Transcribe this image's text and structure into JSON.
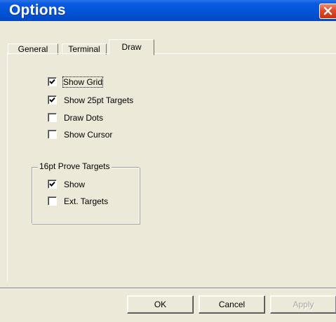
{
  "window": {
    "title": "Options"
  },
  "tabs": [
    {
      "label": "General",
      "active": false
    },
    {
      "label": "Terminal",
      "active": false
    },
    {
      "label": "Draw",
      "active": true
    }
  ],
  "draw": {
    "checkboxes": [
      {
        "label": "Show Grid",
        "checked": true
      },
      {
        "label": "Show 25pt Targets",
        "checked": true
      },
      {
        "label": "Draw Dots",
        "checked": false
      },
      {
        "label": "Show Cursor",
        "checked": false
      }
    ],
    "prove_targets": {
      "title": "16pt Prove Targets",
      "checkboxes": [
        {
          "label": "Show",
          "checked": true
        },
        {
          "label": "Ext. Targets",
          "checked": false
        }
      ]
    }
  },
  "buttons": {
    "ok": "OK",
    "cancel": "Cancel",
    "apply": "Apply"
  },
  "icons": {
    "close": "close-icon",
    "check": "checkmark-icon"
  },
  "colors": {
    "titlebar": "#0254d8",
    "close": "#e0492a",
    "dialog_bg": "#ece9d8"
  }
}
